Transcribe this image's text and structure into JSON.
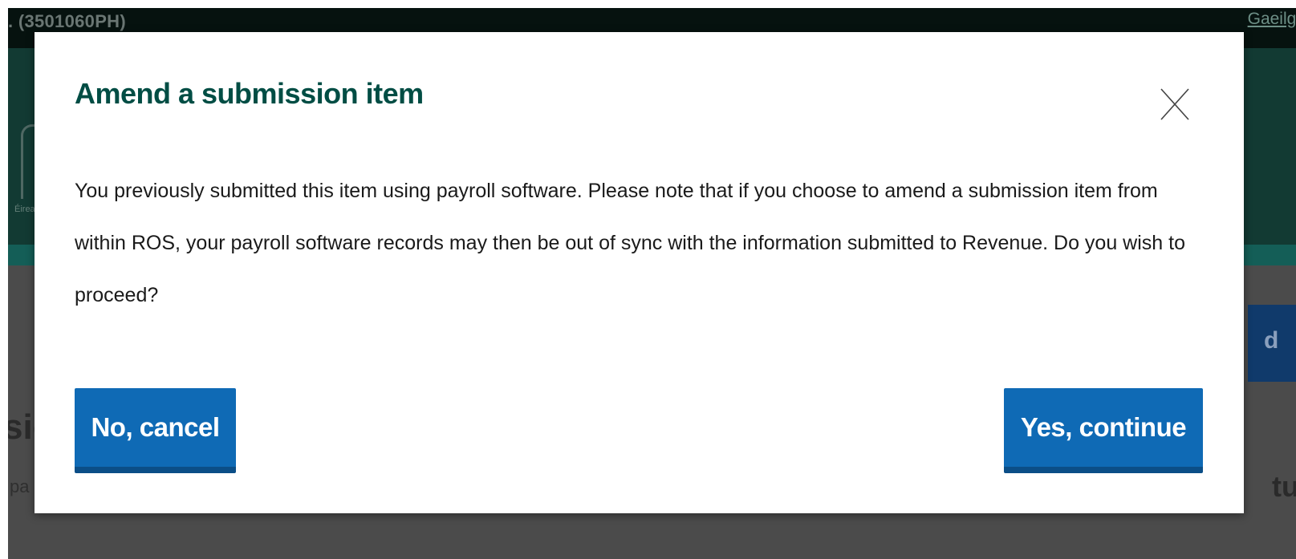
{
  "background": {
    "account_text": ". (3501060PH)",
    "language_link": "Gaeilge",
    "logo_text": "Éirean",
    "side_button_text": "d",
    "heading_fragment": "sio",
    "body_fragment": "pa",
    "right_fragment": "tu"
  },
  "modal": {
    "title": "Amend a submission item",
    "body": "You previously submitted this item using payroll software. Please note that if you choose to amend a submission item from within ROS, your payroll software records may then be out of sync with the information submitted to Revenue. Do you wish to proceed?",
    "cancel_label": "No, cancel",
    "continue_label": "Yes, continue",
    "close_icon": "close-icon"
  },
  "colors": {
    "title": "#004d44",
    "button": "#0f6ab5",
    "button_border": "#0b4e87",
    "overlay_header": "#06120f"
  }
}
